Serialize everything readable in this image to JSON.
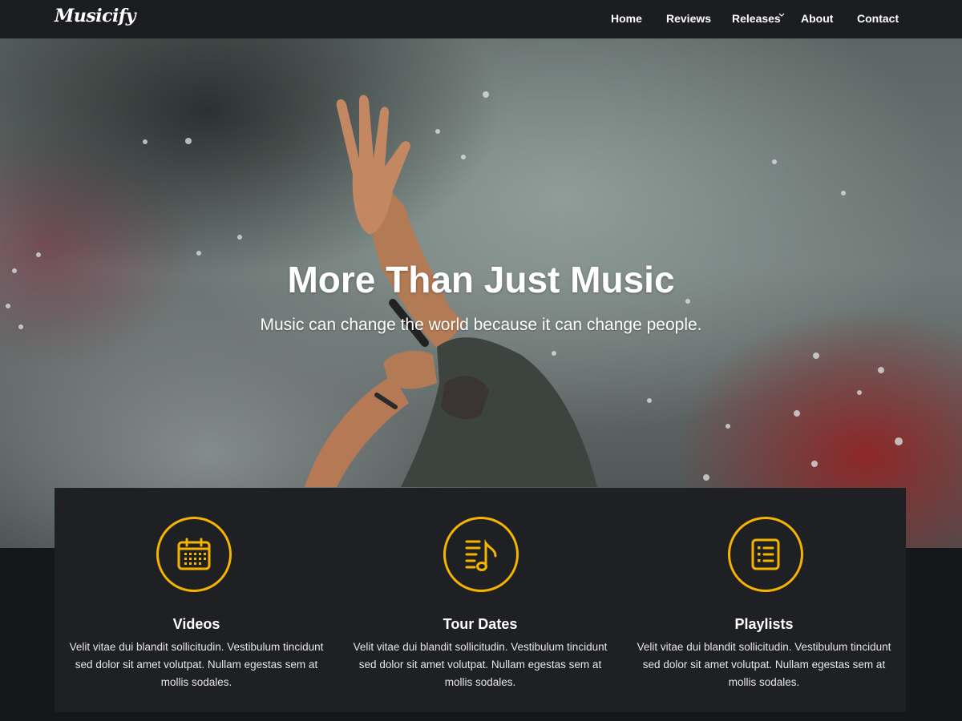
{
  "brand": {
    "logo": "Musicify"
  },
  "nav": {
    "items": [
      {
        "label": "Home"
      },
      {
        "label": "Reviews"
      },
      {
        "label": "Releases"
      },
      {
        "label": "About"
      },
      {
        "label": "Contact"
      }
    ]
  },
  "hero": {
    "title": "More Than Just Music",
    "subtitle": "Music can change the world because it can change people."
  },
  "features": [
    {
      "title": "Videos",
      "icon": "calendar-icon",
      "text": "Velit vitae dui blandit sollicitudin. Vestibulum tincidunt sed dolor sit amet volutpat. Nullam egestas sem at mollis sodales."
    },
    {
      "title": "Tour Dates",
      "icon": "music-list-icon",
      "text": "Velit vitae dui blandit sollicitudin. Vestibulum tincidunt sed dolor sit amet volutpat. Nullam egestas sem at mollis sodales."
    },
    {
      "title": "Playlists",
      "icon": "list-icon",
      "text": "Velit vitae dui blandit sollicitudin. Vestibulum tincidunt sed dolor sit amet volutpat. Nullam egestas sem at mollis sodales."
    }
  ],
  "colors": {
    "accent": "#f5b400",
    "nav_bg": "#1c1d21",
    "panel_bg": "#1f2024",
    "page_bg": "#16171b"
  }
}
